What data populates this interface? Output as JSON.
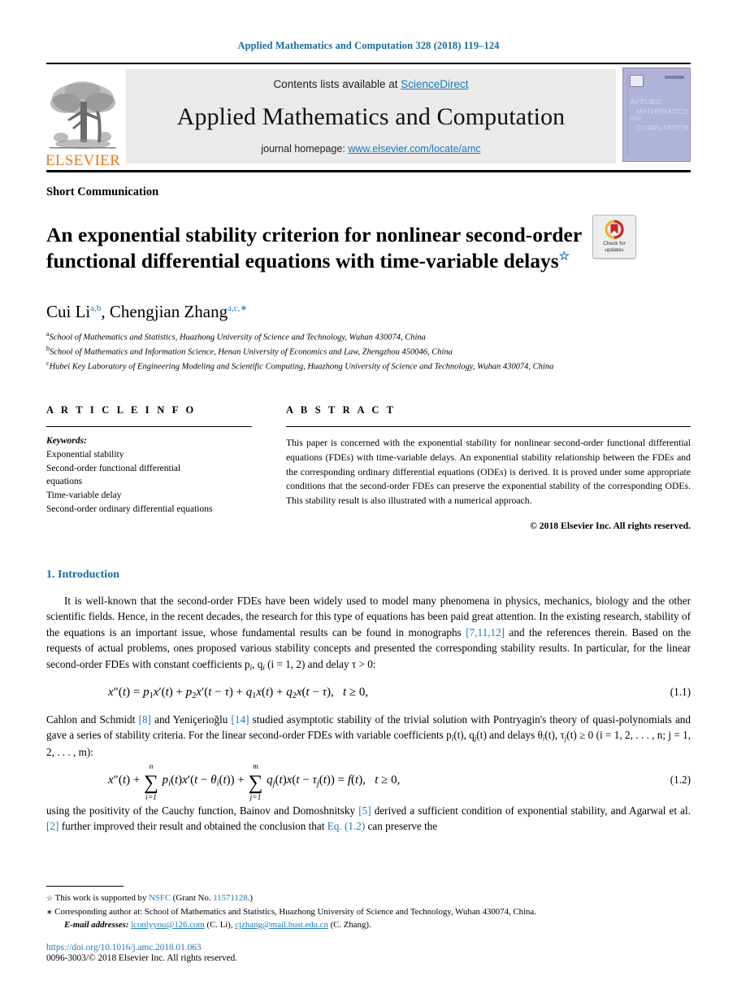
{
  "running_head": "Applied Mathematics and Computation 328 (2018) 119–124",
  "banner": {
    "publisher_logo_text": "ELSEVIER",
    "contents_prefix": "Contents lists available at ",
    "contents_link": "ScienceDirect",
    "journal_title": "Applied Mathematics and Computation",
    "homepage_prefix": "journal homepage: ",
    "homepage_link": "www.elsevier.com/locate/amc",
    "cover": {
      "line1": "APPLIED",
      "line2": "MATHEMATICS",
      "line3": "AND",
      "line4": "COMPUTATION"
    }
  },
  "article": {
    "doctype": "Short Communication",
    "title_line1": "An exponential stability criterion for nonlinear second-order",
    "title_line2": "functional differential equations with time-variable delays",
    "title_star": "☆",
    "crossmark_line1": "Check for",
    "crossmark_line2": "updates",
    "authors": [
      {
        "name": "Cui Li",
        "marks": "a,b"
      },
      {
        "name": "Chengjian Zhang",
        "marks": "a,c,∗"
      }
    ],
    "authors_separator": ", ",
    "affiliations": [
      {
        "mark": "a",
        "text": "School of Mathematics and Statistics, Huazhong University of Science and Technology, Wuhan 430074, China"
      },
      {
        "mark": "b",
        "text": "School of Mathematics and Information Science, Henan University of Economics and Law, Zhengzhou 450046, China"
      },
      {
        "mark": "c",
        "text": "Hubei Key Laboratory of Engineering Modeling and Scientific Computing, Huazhong University of Science and Technology, Wuhan 430074, China"
      }
    ]
  },
  "article_info": {
    "heading": "A R T I C L E   I N F O",
    "keywords_label": "Keywords:",
    "keywords": [
      "Exponential stability",
      "Second-order functional differential",
      "equations",
      "Time-variable delay",
      "Second-order ordinary differential equations"
    ]
  },
  "abstract": {
    "heading": "A B S T R A C T",
    "text": "This paper is concerned with the exponential stability for nonlinear second-order functional differential equations (FDEs) with time-variable delays. An exponential stability relationship between the FDEs and the corresponding ordinary differential equations (ODEs) is derived. It is proved under some appropriate conditions that the second-order FDEs can preserve the exponential stability of the corresponding ODEs. This stability result is also illustrated with a numerical approach.",
    "copyright": "© 2018 Elsevier Inc. All rights reserved."
  },
  "introduction": {
    "section_title": "1. Introduction",
    "para1_a": "It is well-known that the second-order FDEs have been widely used to model many phenomena in physics, mechanics, biology and the other scientific fields. Hence, in the recent decades, the research for this type of equations has been paid great attention. In the existing research, stability of the equations is an important issue, whose fundamental results can be found in monographs ",
    "para1_ref": "[7,11,12]",
    "para1_b": " and the references therein. Based on the requests of actual problems, ones proposed various stability concepts and presented the corresponding stability results. In particular, for the linear second-order FDEs with constant coefficients p",
    "para1_c": ", q",
    "para1_d": " (i = 1, 2) and delay τ > 0:",
    "eq11_num": "(1.1)",
    "para2_a": "Cahlon and Schmidt ",
    "para2_ref1": "[8]",
    "para2_b": " and Yeniçerioğlu ",
    "para2_ref2": "[14]",
    "para2_c": " studied asymptotic stability of the trivial solution with Pontryagin's theory of quasi-polynomials and gave a series of stability criteria. For the linear second-order FDEs with variable coefficients p",
    "para2_d": "(t), q",
    "para2_e": "(t) and delays θ",
    "para2_f": "(t), τ",
    "para2_g": "(t) ≥ 0  (i = 1, 2, . . . , n;  j = 1, 2, . . . , m):",
    "eq12_num": "(1.2)",
    "para3_a": "using the positivity of the Cauchy function, Bainov and Domoshnitsky ",
    "para3_ref1": "[5]",
    "para3_b": " derived a sufficient condition of exponential stability, and Agarwal et al. ",
    "para3_ref2": "[2]",
    "para3_c": " further improved their result and obtained the conclusion that ",
    "para3_ref3": "Eq. (1.2)",
    "para3_d": " can preserve the"
  },
  "footnotes": {
    "fn1_mark": "☆",
    "fn1_a": "This work is supported by ",
    "fn1_funder": "NSFC",
    "fn1_b": " (Grant No. ",
    "fn1_grant": "11571128",
    "fn1_c": ".)",
    "fn2_mark": "∗",
    "fn2_text": "Corresponding author at: School of Mathematics and Statistics, Huazhong University of Science and Technology, Wuhan 430074, China.",
    "email_label": "E-mail addresses:",
    "emails": [
      {
        "address": "lconlyyou@126.com",
        "attribution": " (C. Li),"
      },
      {
        "address": "cjzhang@mail.hust.edu.cn",
        "attribution": " (C. Zhang)."
      }
    ],
    "doi": "https://doi.org/10.1016/j.amc.2018.01.063",
    "issn_line": "0096-3003/© 2018 Elsevier Inc. All rights reserved."
  },
  "colors": {
    "link": "#1a7bb9",
    "running_head": "#1a6ba0",
    "section_title": "#1a6ba0",
    "elsevier_orange": "#e87a22",
    "banner_grey": "#eaeaea",
    "cover_purple": "#b0b2d8"
  }
}
